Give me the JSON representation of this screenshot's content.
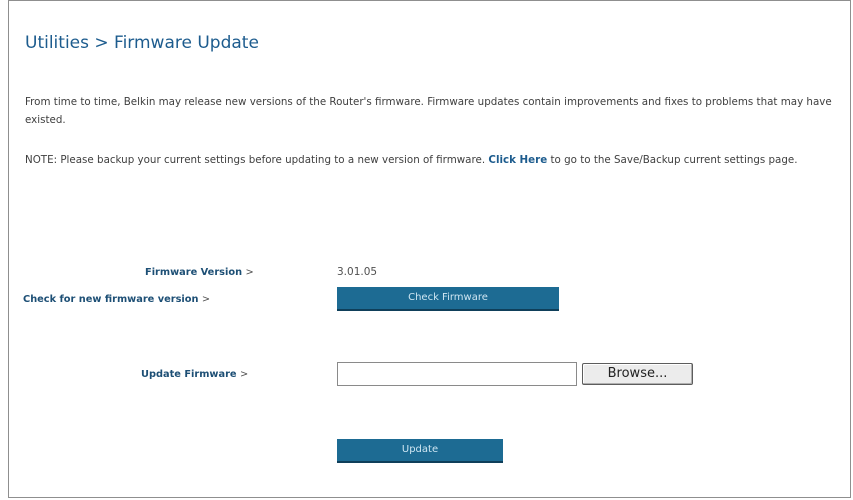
{
  "page": {
    "title": "Utilities > Firmware Update",
    "intro": "From time to time, Belkin may release new versions of the Router's firmware. Firmware updates contain improvements and fixes to problems that may have existed.",
    "note_before": "NOTE: Please backup your current settings before updating to a new version of firmware.",
    "note_link": "Click Here",
    "note_after": "to go to the Save/Backup current settings page."
  },
  "firmware": {
    "version_label": "Firmware Version",
    "version_value": "3.01.05",
    "check_label": "Check for new firmware version",
    "check_button": "Check Firmware",
    "update_label": "Update Firmware",
    "file_value": "",
    "browse_button": "Browse...",
    "update_button": "Update",
    "separator": ">"
  }
}
